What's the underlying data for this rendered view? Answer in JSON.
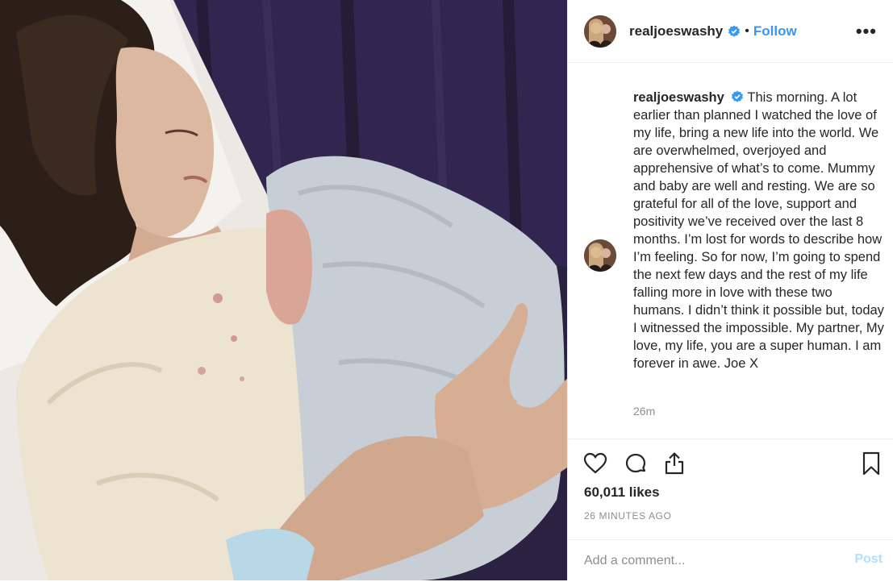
{
  "post": {
    "username": "realjoeswashy",
    "verified": true,
    "follow_label": "Follow",
    "dot": "•",
    "more_label": "•••",
    "caption_user": "realjoeswashy",
    "caption_text": "This morning. A lot earlier than planned I watched the love of my life, bring a new life into the world. We are overwhelmed, overjoyed and apprehensive of what’s to come. Mummy and baby are well and resting. We are so grateful for all of the love, support and positivity we’ve received over the last 8 months. I’m lost for words to describe how I’m feeling. So for now, I’m going to spend the next few days and the rest of my life falling more in love with these two humans. I didn’t think it possible but, today I witnessed the impossible. My partner, My love, my life, you are a super human. I am forever in awe. Joe X",
    "time_ago": "26m",
    "likes": "60,011 likes",
    "timestamp": "26 MINUTES AGO",
    "comment_placeholder": "Add a comment...",
    "post_label": "Post"
  },
  "icons": {
    "like": "heart-icon",
    "comment": "speech-bubble-icon",
    "share": "share-icon",
    "save": "bookmark-icon",
    "verified": "verified-badge-icon",
    "more": "more-options-icon"
  },
  "colors": {
    "accent": "#3897f0",
    "text": "#262626",
    "muted": "#8e8e8e",
    "border": "#efefef",
    "post_disabled": "#b2dffc"
  }
}
